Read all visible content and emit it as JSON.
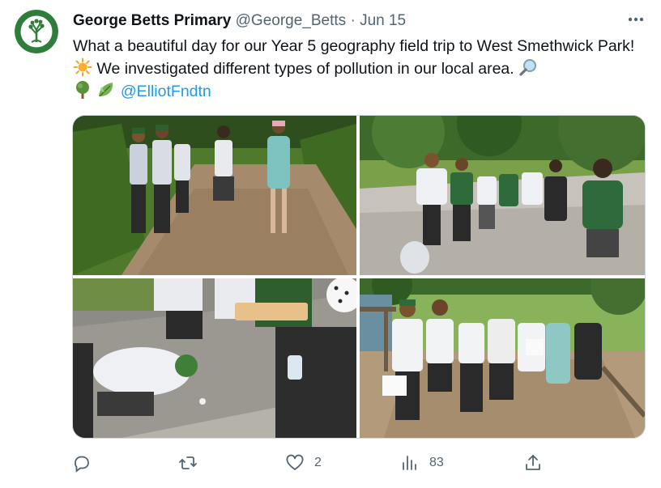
{
  "tweet": {
    "author_name": "George Betts Primary",
    "handle": "@George_Betts",
    "separator": "·",
    "date": "Jun 15",
    "text_part1": "What a beautiful day for our Year 5 geography field trip to West Smethwick Park!",
    "text_part2": "We investigated different types of pollution in our local area.",
    "mention": "@ElliotFndtn",
    "emojis": [
      "sun-emoji",
      "magnifying-glass-emoji",
      "tree-emoji",
      "leaf-emoji"
    ]
  },
  "media": {
    "photos": [
      {
        "name": "photo-pupils-on-woodland-path"
      },
      {
        "name": "photo-group-by-park-path"
      },
      {
        "name": "photo-pupils-collecting-samples"
      },
      {
        "name": "photo-group-on-boardwalk"
      }
    ]
  },
  "actions": {
    "reply_icon": "reply-icon",
    "retweet_icon": "retweet-icon",
    "like_icon": "heart-icon",
    "like_count": "2",
    "views_icon": "views-icon",
    "views_count": "83",
    "share_icon": "share-icon"
  },
  "colors": {
    "link": "#1d9bf0",
    "secondary_text": "#536471",
    "primary_text": "#0f1419",
    "logo_green": "#2e7d3a"
  }
}
